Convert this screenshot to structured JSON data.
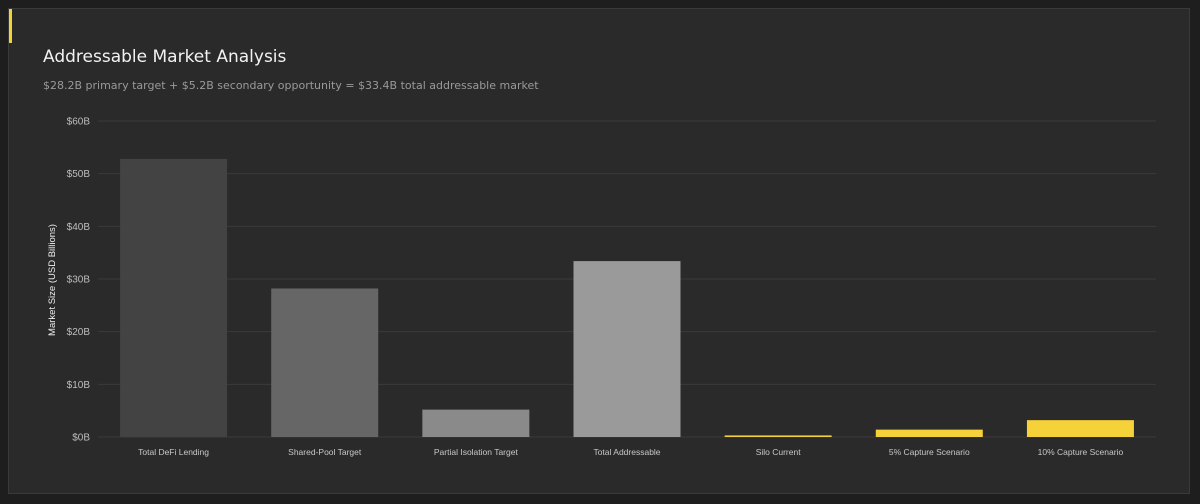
{
  "header": {
    "title": "Addressable Market Analysis",
    "subtitle": "$28.2B primary target + $5.2B secondary opportunity = $33.4B total addressable market"
  },
  "colors": {
    "accent": "#f0d43a",
    "gridline": "#3b3b3b"
  },
  "chart_data": {
    "type": "bar",
    "title": "Addressable Market Analysis",
    "ylabel": "Market Size (USD Billions)",
    "xlabel": "",
    "ylim": [
      0,
      60
    ],
    "yticks": [
      0,
      10,
      20,
      30,
      40,
      50,
      60
    ],
    "ytick_labels": [
      "$0B",
      "$10B",
      "$20B",
      "$30B",
      "$40B",
      "$50B",
      "$60B"
    ],
    "grid": true,
    "categories": [
      "Total DeFi Lending",
      "Shared-Pool Target",
      "Partial Isolation Target",
      "Total Addressable",
      "Silo Current",
      "5% Capture Scenario",
      "10% Capture Scenario"
    ],
    "values": [
      52.8,
      28.2,
      5.2,
      33.4,
      0.3,
      1.4,
      3.2
    ],
    "bar_colors": [
      "#434343",
      "#666666",
      "#8a8a8a",
      "#9a9a9a",
      "#f5d13a",
      "#f5d13a",
      "#f5d13a"
    ]
  }
}
